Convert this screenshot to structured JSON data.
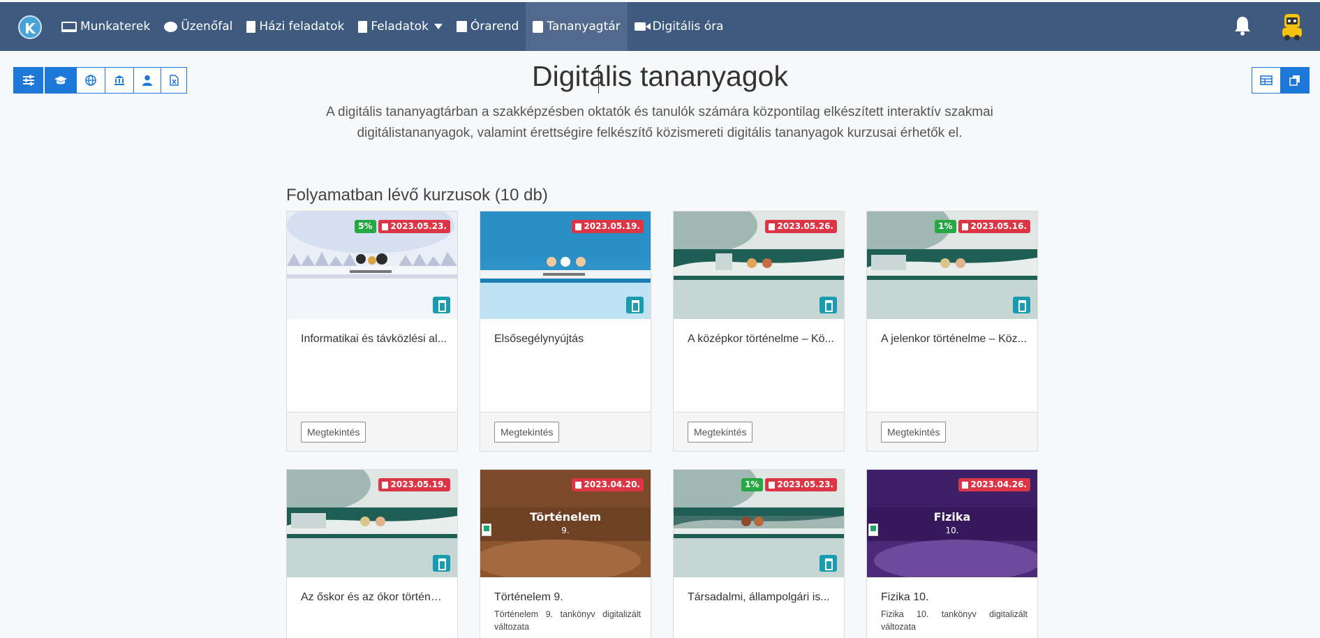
{
  "nav": {
    "logo_letter": "K",
    "items": [
      {
        "label": "Munkaterek",
        "icon": "laptop-icon"
      },
      {
        "label": "Üzenőfal",
        "icon": "chat-icon"
      },
      {
        "label": "Házi feladatok",
        "icon": "file-icon"
      },
      {
        "label": "Feladatok",
        "icon": "clipboard-icon"
      },
      {
        "label": "Órarend",
        "icon": "calendar-icon"
      },
      {
        "label": "Tananyagtár",
        "icon": "book-icon"
      },
      {
        "label": "Digitális óra",
        "icon": "video-icon"
      }
    ],
    "active": "Tananyagtár"
  },
  "filters": [
    "sliders-icon",
    "graduation-cap-icon",
    "globe-icon",
    "institution-icon",
    "user-icon",
    "excel-file-icon"
  ],
  "views": [
    "grid-view-icon",
    "card-view-icon"
  ],
  "page": {
    "title": "Digitális tananyagok",
    "intro": "A digitális tananyagtárban a szakképzésben oktatók és tanulók számára központilag elkészített interaktív szakmai digitálistananyagok, valamint érettségire felkészítő közismereti digitális tananyagok kurzusai érhetők el.",
    "section_title": "Folyamatban lévő kurzusok (10 db)"
  },
  "cards": [
    {
      "title": "Informatikai és távközlési al...",
      "desc": "",
      "percent": "5%",
      "date": "2023.05.23.",
      "button": "Megtekintés",
      "theme": "winter"
    },
    {
      "title": "Elsősegélynyújtás",
      "desc": "",
      "percent": "",
      "date": "2023.05.19.",
      "button": "Megtekintés",
      "theme": "blue"
    },
    {
      "title": "A középkor történelme – Kö...",
      "desc": "",
      "percent": "",
      "date": "2023.05.26.",
      "button": "Megtekintés",
      "theme": "teal"
    },
    {
      "title": "A jelenkor történelme – Köz...",
      "desc": "",
      "percent": "1%",
      "date": "2023.05.16.",
      "button": "Megtekintés",
      "theme": "teal"
    },
    {
      "title": "Az őskor és az ókor történel...",
      "desc": "",
      "percent": "",
      "date": "2023.05.19.",
      "button": "Megtekintés",
      "theme": "teal"
    },
    {
      "title": "Történelem 9.",
      "desc": "Történelem 9. tankönyv digitalizált változata",
      "percent": "",
      "date": "2023.04.20.",
      "button": "Megtekintés",
      "theme": "brown",
      "book_title": "Történelem",
      "book_sub": "9."
    },
    {
      "title": "Társadalmi, állampolgári is...",
      "desc": "",
      "percent": "1%",
      "date": "2023.05.23.",
      "button": "Megtekintés",
      "theme": "teal"
    },
    {
      "title": "Fizika 10.",
      "desc": "Fizika 10. tankönyv digitalizált változata",
      "percent": "",
      "date": "2023.04.26.",
      "button": "Megtekintés",
      "theme": "purple",
      "book_title": "Fizika",
      "book_sub": "10."
    }
  ]
}
